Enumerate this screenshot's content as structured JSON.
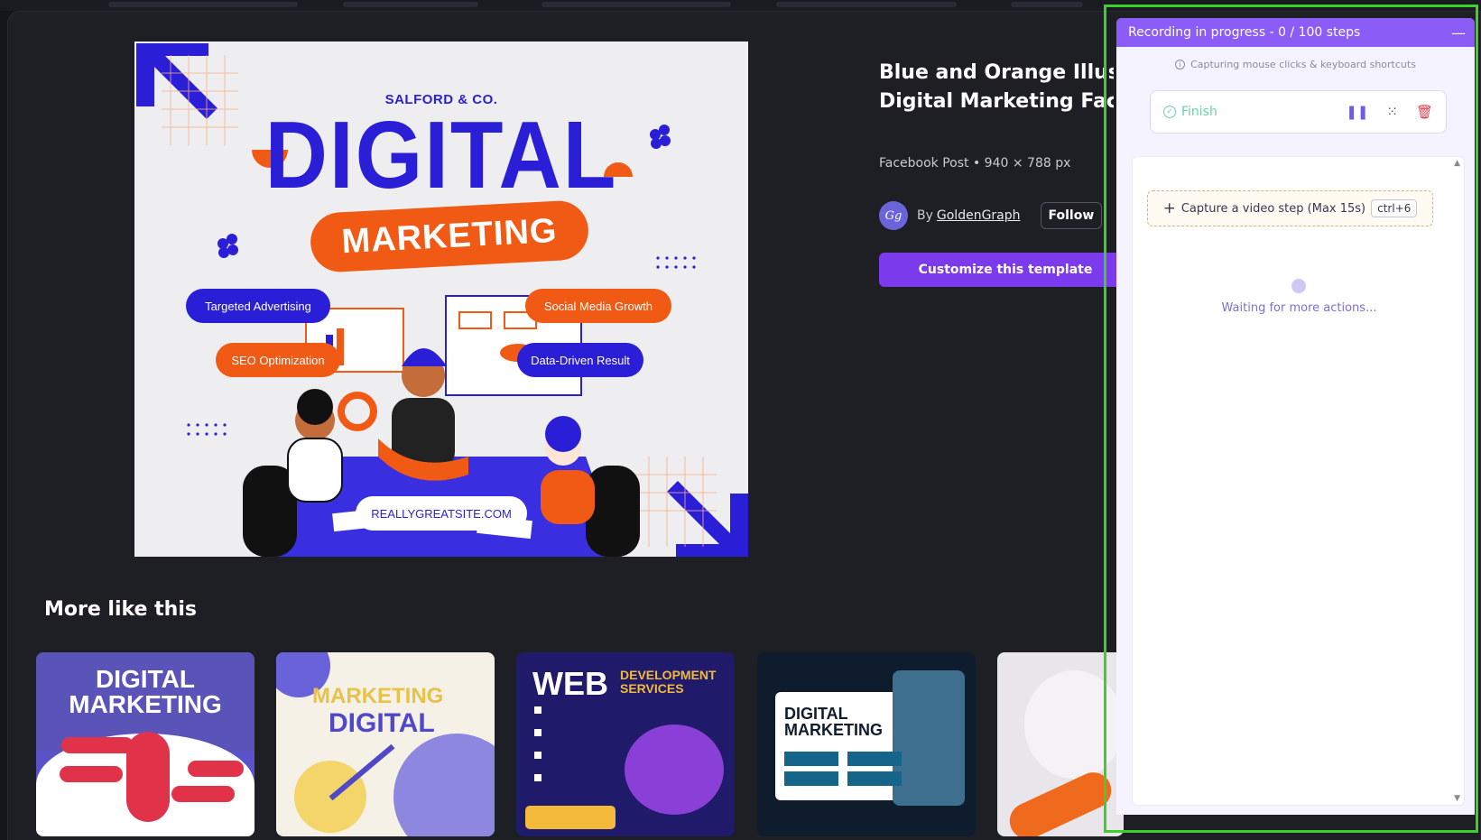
{
  "preview": {
    "brand": "SALFORD & CO.",
    "headline": "DIGITAL",
    "subheadline": "MARKETING",
    "tags": [
      "Targeted Advertising",
      "Social Media Growth",
      "SEO Optimization",
      "Data-Driven Result"
    ],
    "website": "REALLYGREATSITE.COM"
  },
  "info": {
    "title": "Blue and Orange Illustrated Digital Marketing Facebook Post",
    "title_line1": "Blue and Orange Illustra",
    "title_line2": "Digital Marketing Faceb",
    "meta": "Facebook Post • 940 × 788 px",
    "avatar_initials": "Gg",
    "by": "By",
    "author": "GoldenGraph",
    "follow_label": "Follow",
    "customize_label": "Customize this template"
  },
  "more": {
    "title": "More like this",
    "cards": [
      {
        "line1": "DIGITAL",
        "line2": "MARKETING"
      },
      {
        "line1": "MARKETING",
        "line2": "DIGITAL"
      },
      {
        "line1": "WEB",
        "line2": "DEVELOPMENT SERVICES"
      },
      {
        "line1": "DIGITAL",
        "line2": "MARKETING"
      }
    ]
  },
  "recorder": {
    "header": "Recording in progress - 0 / 100 steps",
    "minimize": "—",
    "hint": "Capturing mouse clicks & keyboard shortcuts",
    "finish_label": "Finish",
    "capture_label": "Capture a video step (Max 15s)",
    "shortcut": "ctrl+6",
    "waiting": "Waiting for more actions..."
  },
  "colors": {
    "accent_purple": "#7c3aed",
    "recorder_header": "#8b5cf6",
    "highlight_outline": "#3ecf2f",
    "brand_blue": "#2a1fd6",
    "brand_orange": "#f05a14"
  }
}
